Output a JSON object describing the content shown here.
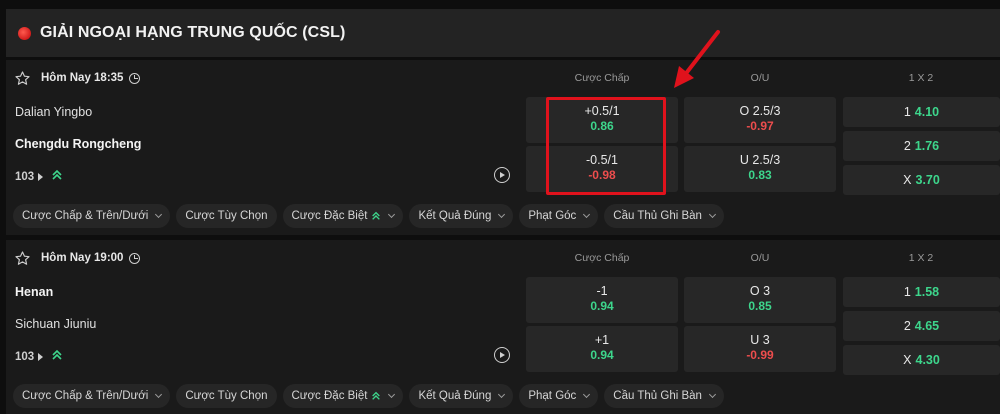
{
  "league": {
    "title": "GIẢI NGOẠI HẠNG TRUNG QUỐC (CSL)"
  },
  "columns": {
    "hdp": "Cược Chấp",
    "ou": "O/U",
    "x12": "1 X 2"
  },
  "matches": [
    {
      "time": "Hôm Nay 18:35",
      "home": "Dalian Yingbo",
      "away": "Chengdu Rongcheng",
      "more": "103",
      "hdp": [
        {
          "line": "+0.5/1",
          "odds": "0.86"
        },
        {
          "line": "-0.5/1",
          "odds": "-0.98"
        }
      ],
      "ou": [
        {
          "line": "O 2.5/3",
          "odds": "-0.97"
        },
        {
          "line": "U 2.5/3",
          "odds": "0.83"
        }
      ],
      "x12": [
        {
          "label": "1",
          "odds": "4.10"
        },
        {
          "label": "2",
          "odds": "1.76"
        },
        {
          "label": "X",
          "odds": "3.70"
        }
      ]
    },
    {
      "time": "Hôm Nay 19:00",
      "home": "Henan",
      "away": "Sichuan Jiuniu",
      "more": "103",
      "hdp": [
        {
          "line": "-1",
          "odds": "0.94"
        },
        {
          "line": "+1",
          "odds": "0.94"
        }
      ],
      "ou": [
        {
          "line": "O 3",
          "odds": "0.85"
        },
        {
          "line": "U 3",
          "odds": "-0.99"
        }
      ],
      "x12": [
        {
          "label": "1",
          "odds": "1.58"
        },
        {
          "label": "2",
          "odds": "4.65"
        },
        {
          "label": "X",
          "odds": "4.30"
        }
      ]
    }
  ],
  "tabs": [
    "Cược Chấp & Trên/Dưới",
    "Cược Tùy Chọn",
    "Cược Đặc Biệt",
    "Kết Quả Đúng",
    "Phạt Góc",
    "Cầu Thủ Ghi Bàn"
  ],
  "colors": {
    "positive": "#3dd68c",
    "negative": "#ee4d4d",
    "annotation": "#e0121c"
  },
  "icons": [
    "flag-icon",
    "star-icon",
    "clock-icon",
    "caret-right-icon",
    "stats-icon",
    "play-icon",
    "chevron-down-icon"
  ]
}
